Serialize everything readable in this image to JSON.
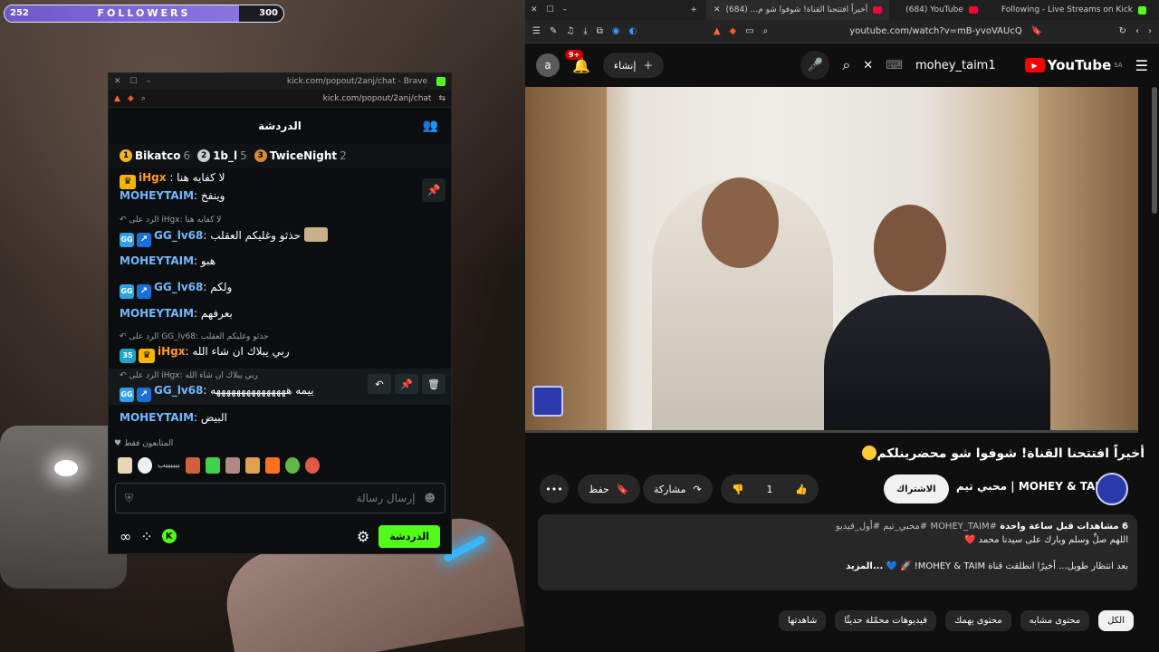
{
  "overlay": {
    "followers_label": "FOLLOWERS",
    "followers_current": "252",
    "followers_goal": "300",
    "progress": 0.84
  },
  "chat_window": {
    "title": "kick.com/popout/2anj/chat - Brave",
    "url": "kick.com/popout/2anj/chat",
    "header": "الدردشة",
    "top_gifters": [
      {
        "rank": "1",
        "name": "Bikatco",
        "count": "6",
        "color": "#f2b61d"
      },
      {
        "rank": "2",
        "name": "1b_l",
        "count": "5",
        "color": "#c9ced4"
      },
      {
        "rank": "3",
        "name": "TwiceNight",
        "count": "2",
        "color": "#d98b3a"
      }
    ],
    "messages": [
      {
        "user": "MOHEYTAIM",
        "text": "وينفخ"
      },
      {
        "reply": "الرد على iHgx: لا كفايه هنا"
      },
      {
        "user": "GG_lv68",
        "text": "حذثو وغليكم العقلب"
      },
      {
        "user": "MOHEYTAIM",
        "text": "هبو"
      },
      {
        "user": "GG_lv68",
        "text": "ولكم"
      },
      {
        "user": "MOHEYTAIM",
        "text": "بعرفهم"
      },
      {
        "reply": "الرد على GG_lv68: حذثو وغليكم العقلب"
      },
      {
        "user": "iHgx",
        "text": "ربي يبلاك ان شاء الله",
        "level": "35"
      },
      {
        "reply": "الرد على iHgx: ربي يبلاك ان شاء الله"
      },
      {
        "user": "GG_lv68",
        "text": "ييمه هههههههههههههههه"
      },
      {
        "user": "MOHEYTAIM",
        "text": "البيض"
      }
    ],
    "top_cut": "لا كفايه هنا",
    "top_cut_user": "iHgx",
    "subs_only": "المتابعون فقط",
    "emote_text": "ببببببب",
    "input_placeholder": "إرسال رسالة",
    "chat_button": "الدردشة"
  },
  "browser": {
    "tabs": [
      {
        "label": "أخيراً افتتحنا القناة! شوفوا شو م... (684)",
        "active": true
      },
      {
        "label": "(684) YouTube",
        "active": false
      },
      {
        "label": "Following - Live Streams on Kick",
        "active": false
      }
    ],
    "url": "youtube.com/watch?v=mB-yvoVAUcQ",
    "avatar_letter": "a",
    "notif_count": "9+",
    "create_label": "إنشاء",
    "search_query": "mohey_taim1",
    "logo": "YouTube",
    "logo_region": "SA",
    "video_title": "أخيراً افتتحنا القناة! شوفوا شو محضرينلكم",
    "channel_name": "محبي تيم | MOHEY & TAIM",
    "subscribe": "الاشتراك",
    "likes": "1",
    "share": "مشاركة",
    "save": "حفظ",
    "desc_stats": "6 مشاهدات  قبل ساعة واحدة",
    "desc_tags": "#MOHEY_TAIM #محبي_تيم #أول_فيديو",
    "desc_line2": "اللهم صلِّ وسلم وبارك على سيدنا محمد ❤️",
    "desc_line3": "بعد انتظار طويل... أخيرًا انطلقت قناة MOHEY & TAIM! 🚀 💙",
    "desc_more": "...المزيد",
    "chips": [
      "الكل",
      "محتوى مشابه",
      "محتوى يهمك",
      "فيديوهات محمّلة حديثًا",
      "شاهدتها"
    ]
  }
}
